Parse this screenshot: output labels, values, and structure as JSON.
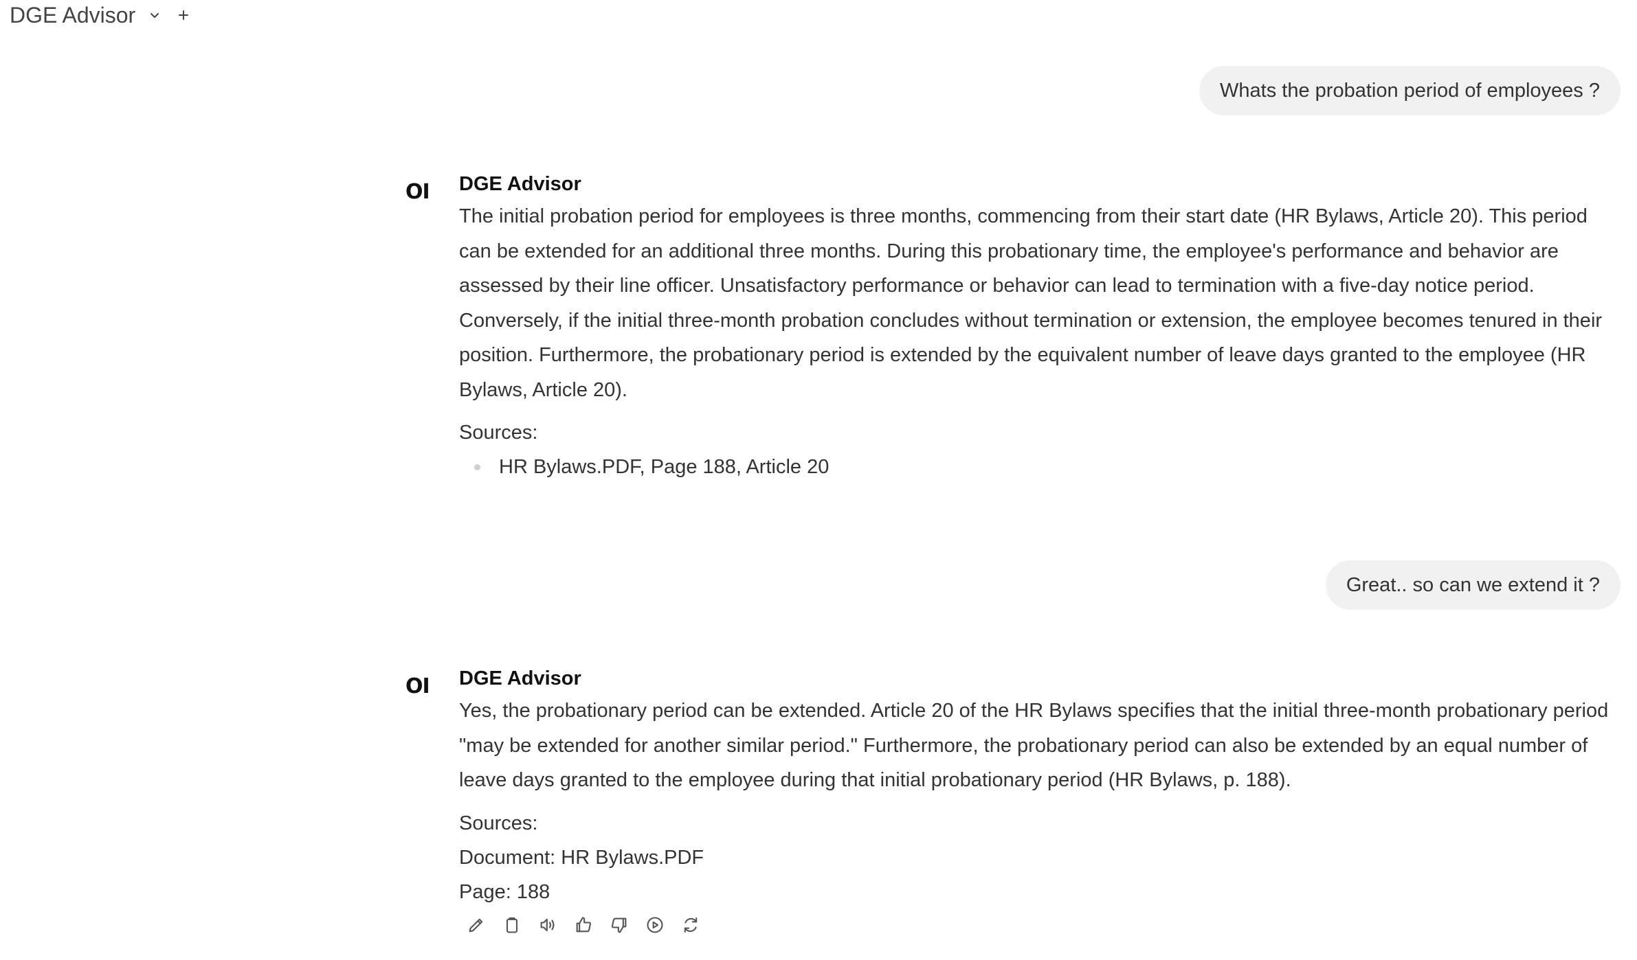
{
  "header": {
    "model_name": "DGE Advisor",
    "dropdown_icon": "chevron-down-icon",
    "new_chat_icon": "plus-icon"
  },
  "messages": [
    {
      "role": "user",
      "text": "Whats the probation period of employees ?"
    },
    {
      "role": "assistant",
      "avatar": "OI",
      "name": "DGE Advisor",
      "body": "The initial probation period for employees is three months, commencing from their start date (HR Bylaws, Article 20). This period can be extended for an additional three months. During this probationary time, the employee's performance and behavior are assessed by their line officer. Unsatisfactory performance or behavior can lead to termination with a five-day notice period. Conversely, if the initial three-month probation concludes without termination or extension, the employee becomes tenured in their position. Furthermore, the probationary period is extended by the equivalent number of leave days granted to the employee (HR Bylaws, Article 20).",
      "sources_label": "Sources:",
      "sources": [
        "HR Bylaws.PDF, Page 188, Article 20"
      ]
    },
    {
      "role": "user",
      "text": "Great.. so can we extend it ?"
    },
    {
      "role": "assistant",
      "avatar": "OI",
      "name": "DGE Advisor",
      "body": "Yes, the probationary period can be extended. Article 20 of the HR Bylaws specifies that the initial three-month probationary period \"may be extended for another similar period.\" Furthermore, the probationary period can also be extended by an equal number of leave days granted to the employee during that initial probationary period (HR Bylaws, p. 188).",
      "sources_label": "Sources:",
      "document_line": "Document: HR Bylaws.PDF",
      "page_line": "Page: 188",
      "actions": [
        "edit-icon",
        "copy-icon",
        "read-aloud-icon",
        "thumbs-up-icon",
        "thumbs-down-icon",
        "play-icon",
        "regenerate-icon"
      ]
    }
  ]
}
